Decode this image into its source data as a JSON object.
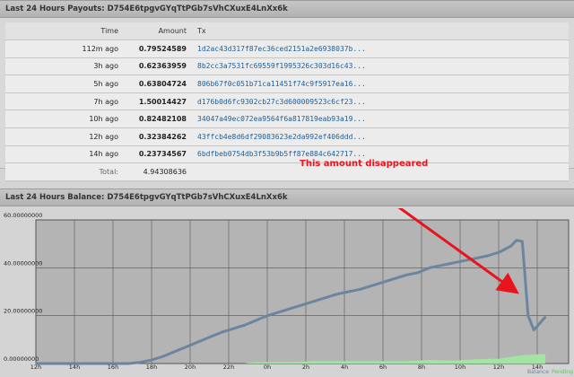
{
  "payouts": {
    "header": "Last 24 Hours Payouts: D754E6tpgvGYqTtPGb7sVhCXuxE4LnXx6k",
    "columns": [
      "Time",
      "Amount",
      "Tx"
    ],
    "rows": [
      {
        "time": "112m ago",
        "amount": "0.79524589",
        "tx": "1d2ac43d317f87ec36ced2151a2e6938037b..."
      },
      {
        "time": "3h ago",
        "amount": "0.62363959",
        "tx": "8b2cc3a7531fc69559f1995326c303d16c43..."
      },
      {
        "time": "5h ago",
        "amount": "0.63804724",
        "tx": "806b67f0c051b71ca11451f74c9f5917ea16..."
      },
      {
        "time": "7h ago",
        "amount": "1.50014427",
        "tx": "d176b0d6fc9302cb27c3d600009523c6cf23..."
      },
      {
        "time": "10h ago",
        "amount": "0.82482108",
        "tx": "34047a49ec072ea9564f6a817819eab93a19..."
      },
      {
        "time": "12h ago",
        "amount": "0.32384262",
        "tx": "43ffcb4e8d6df29083623e2da992ef406ddd..."
      },
      {
        "time": "14h ago",
        "amount": "0.23734567",
        "tx": "6bdfbeb0754db3f53b9b5ff87e884c642717..."
      }
    ],
    "total_label": "Total:",
    "total_amount": "4.94308636"
  },
  "annotation": {
    "text": "This amount disappeared",
    "color": "#e8141e"
  },
  "balance": {
    "header": "Last 24 Hours Balance: D754E6tpgvGYqTtPGb7sVhCXuxE4LnXx6k"
  },
  "chart_data": {
    "type": "line",
    "title": "",
    "xlabel": "",
    "ylabel": "",
    "x_tick_labels": [
      "12h",
      "14h",
      "16h",
      "18h",
      "20h",
      "22h",
      "0h",
      "2h",
      "4h",
      "6h",
      "8h",
      "10h",
      "12h",
      "14h"
    ],
    "y_tick_labels": [
      "60.00000000",
      "40.00000000",
      "20.00000000",
      "0.00000000"
    ],
    "ylim": [
      0,
      60
    ],
    "grid": true,
    "legend_position": "bottom-right",
    "legend_entries": [
      "Balance",
      "Pending"
    ],
    "series": [
      {
        "name": "Balance",
        "color": "#6c859f",
        "x": [
          12,
          14,
          16,
          18,
          20,
          21,
          22,
          23,
          24,
          25,
          26,
          27,
          28,
          29,
          30,
          31,
          32,
          33,
          34,
          35,
          36,
          37,
          38,
          39,
          40,
          41,
          42,
          43,
          44,
          45,
          46,
          47,
          48,
          49,
          50,
          51,
          52,
          53,
          53.5,
          54,
          54.5,
          55,
          56
        ],
        "values": [
          0,
          0,
          0,
          0,
          0,
          0.5,
          1.5,
          3,
          5,
          7,
          9,
          11,
          13,
          14.5,
          16,
          18,
          20,
          21.5,
          23,
          24.5,
          26,
          27.5,
          29,
          30,
          31,
          32.5,
          34,
          35.5,
          37,
          38,
          40,
          41,
          42,
          43,
          44,
          45,
          46.5,
          49,
          51.5,
          51,
          20,
          14,
          19.5
        ]
      },
      {
        "name": "Pending",
        "color": "#a3e3a3",
        "x": [
          24,
          30,
          31,
          34,
          36,
          40,
          44,
          46,
          48,
          50,
          52,
          54,
          56
        ],
        "values": [
          0,
          0,
          0.6,
          0.6,
          1,
          1,
          1,
          1.5,
          1.2,
          1.8,
          2,
          3.5,
          4
        ]
      }
    ]
  }
}
